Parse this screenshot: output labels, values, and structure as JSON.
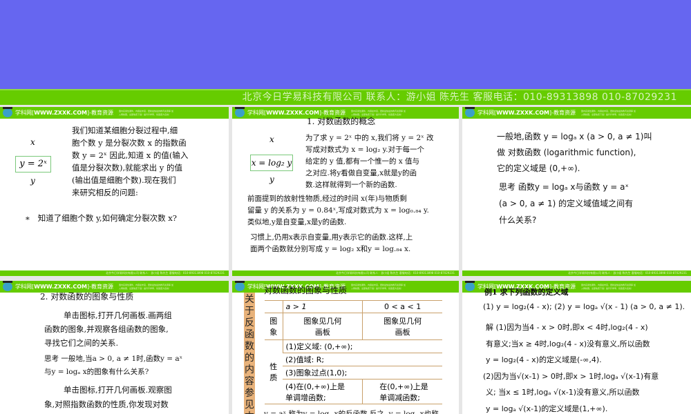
{
  "banner": {
    "company": "北京今日学易科技有限公司 联系人：游小姐 陈先生 客服电话：010-89313898 010-87029231"
  },
  "slide_header": {
    "site": "学科网[",
    "url": "WWW.ZXXK.COM",
    "suffix": "]-教育资源",
    "tagline": "国内实用性课件，内容最丰富，更新最快最的教育资源库 加入网校圈，全部免费下载！提升升学率，创造更大名校！"
  },
  "slide_footer": "北京今日学易科技有限公司 联系人：游小姐 陈先生 客服电话：010-89313898 010-87029231",
  "slides": [
    {
      "diagram": {
        "top": "x",
        "formula": "y = 2ˣ",
        "bottom": "y"
      },
      "lines": [
        "我们知道某细胞分裂过程中,细",
        "胞个数 y 是分裂次数 x 的指数函",
        "数 y = 2ˣ 因此,知道 x 的值(输入",
        "值是分裂次数),就能求出 y 的值",
        "(输出值是细胞个数).现在我们",
        "来研究相反的问题:"
      ],
      "bullet": "知道了细胞个数 y,如何确定分裂次数 x?"
    },
    {
      "title": "1.  对数函数的概念",
      "diagram": {
        "top": "x",
        "formula": "x = log₂ y",
        "bottom": "y"
      },
      "lines": [
        "为了求 y = 2ˣ 中的 x,我们将 y = 2ˣ 改",
        "写成对数式为 x = log₂ y.对于每一个",
        "给定的 y 值,都有一个惟一的 x 值与",
        "之对应.将y看做自变量,x就是y的函",
        "数.这样就得到一个新的函数."
      ],
      "para2": [
        "前面提到的放射性物质,经过的时间 x(年)与物质剩",
        "留量 y 的关系为 y = 0.84ˣ,写成对数式为 x = log₀.₈₄ y.",
        "类似地,y是自变量,x是y的函数."
      ],
      "para3": [
        "习惯上,仍用x表示自变量,用y表示它的函数.这样,上",
        "面两个函数就分别写成 y = log₂ x和y = log.₈₄ x."
      ]
    },
    {
      "lines": [
        "一般地,函数 y = logₐ x (a > 0, a ≠ 1)叫",
        "做 对数函数 (logarithmic function),",
        "它的定义域是 (0,+∞)."
      ],
      "think": [
        "思考   函数y = logₐ x与函数 y = aˣ",
        "(a > 0, a ≠ 1) 的定义域值域之间有",
        "什么关系?"
      ]
    },
    {
      "title": "2.  对数函数的图象与性质",
      "p1": [
        "单击图标,打开几何画板.画两组",
        "函数的图象,并观察各组函数的图象,",
        "寻找它们之间的关系."
      ],
      "think": [
        "思考   一般地,当a > 0, a ≠ 1时,函数y = aˣ",
        "与y = logₐ x的图象有什么关系?"
      ],
      "p2": [
        "单击图标,打开几何画板.观察图",
        "象,对照指数函数的性质,你发现对数"
      ]
    },
    {
      "title": "对数函数的图象与性质",
      "side": "关于反函数的内容参见本节的",
      "table": {
        "h1": "a > 1",
        "h2": "0 < a < 1",
        "row_graph": "图象",
        "graph_cell": "图象见几何画板",
        "row_prop": "性质",
        "p1": "(1)定义域: (0,+∞);",
        "p2": "(2)值域: R;",
        "p3": "(3)图象过点(1,0);",
        "p4a": "(4)在(0,+∞)上是",
        "p4b": "单调增函数;",
        "p4c": "在(0,+∞)上是",
        "p4d": "单调减函数;"
      },
      "bottom": "y = aˣ 称为y = logₐ x的反函数,反之, y = logₐ x也称"
    },
    {
      "title": "例1   求下列函数的定义域",
      "q": "(1) y = log₂(4 - x);   (2) y = logₐ √(x - 1) (a > 0, a ≠ 1).",
      "lines": [
        "解   (1)因为当4 - x > 0时,即x < 4时,log₂(4 - x)",
        "有意义;当x ≥ 4时,log₂(4 - x)没有意义,所以函数",
        "y = log₂(4 - x)的定义域是(-∞,4).",
        "(2)因为当√(x-1) > 0时,即x > 1时,logₐ √(x-1)有意",
        "义; 当x ≤ 1时,logₐ √(x-1)没有意义,所以函数",
        "y = logₐ √(x-1)的定义域是(1,+∞)."
      ]
    }
  ]
}
